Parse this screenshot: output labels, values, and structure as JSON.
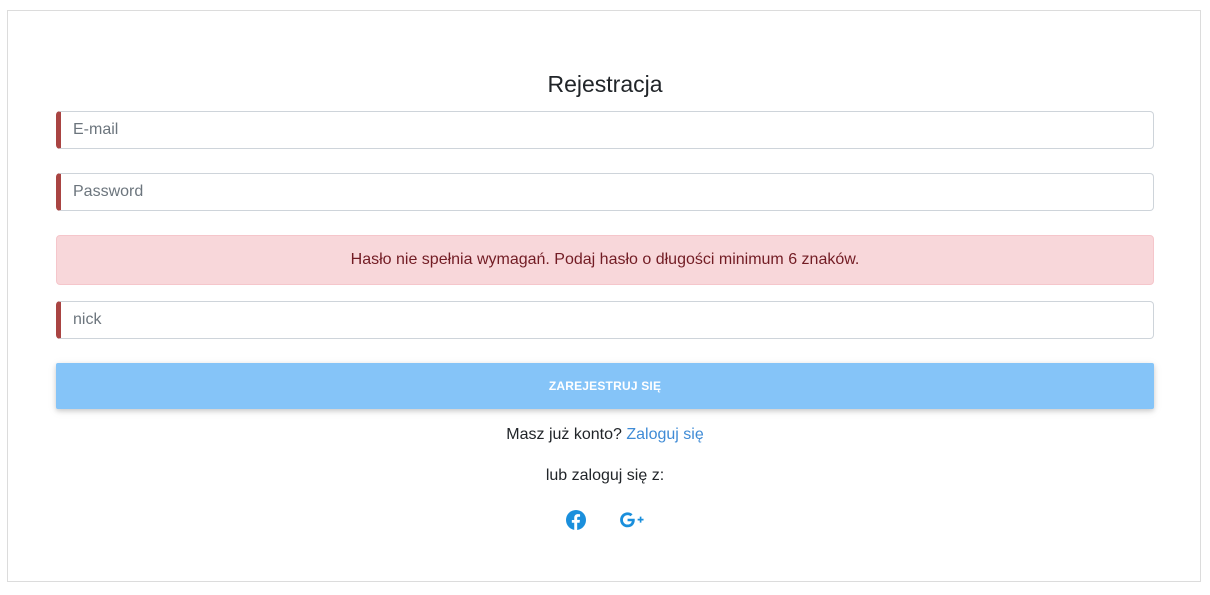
{
  "form": {
    "title": "Rejestracja",
    "email_placeholder": "E-mail",
    "password_placeholder": "Password",
    "error_message": "Hasło nie spełnia wymagań. Podaj hasło o długości minimum 6 znaków.",
    "nick_placeholder": "nick",
    "submit_label": "ZAREJESTRUJ SIĘ"
  },
  "login": {
    "prompt": "Masz już konto?",
    "link_label": "Zaloguj się"
  },
  "alternative": {
    "label": "lub zaloguj się z:",
    "providers": [
      {
        "name": "facebook",
        "icon": "facebook-icon"
      },
      {
        "name": "google-plus",
        "icon": "google-plus-icon"
      }
    ]
  },
  "colors": {
    "accent": "#85c4f8",
    "invalid_border": "#a94442",
    "alert_bg": "#f8d7da",
    "link": "#3f8bd6",
    "social_icon": "#1a8fdc"
  }
}
